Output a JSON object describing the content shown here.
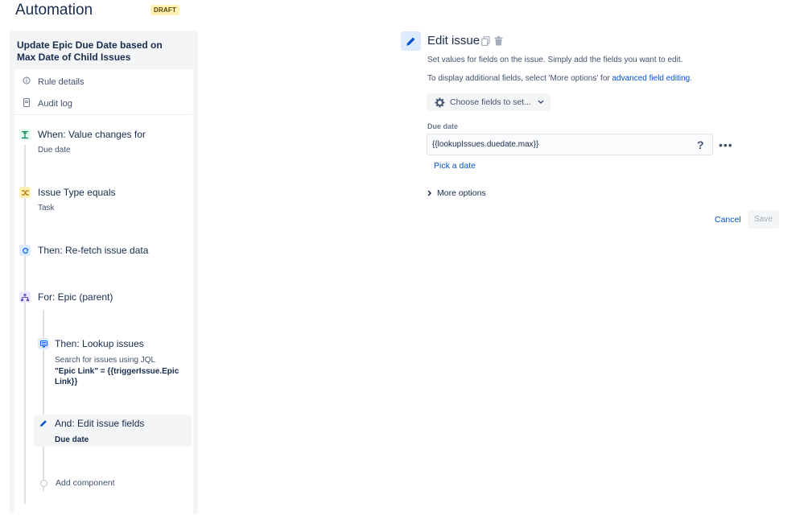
{
  "header": {
    "title": "Automation",
    "badge": "DRAFT"
  },
  "rule": {
    "name": "Update Epic Due Date based on Max Date of Child Issues",
    "meta": [
      {
        "label": "Rule details",
        "icon": "info-icon"
      },
      {
        "label": "Audit log",
        "icon": "document-icon"
      }
    ]
  },
  "steps": {
    "trigger": {
      "title": "When: Value changes for",
      "sub": "Due date",
      "icon": "trigger-icon",
      "color": "#00875a",
      "bg": "#e3fcef"
    },
    "condition": {
      "title": "Issue Type equals",
      "sub": "Task",
      "icon": "condition-icon",
      "color": "#ff991f",
      "bg": "#fff0b3"
    },
    "refetch": {
      "title": "Then: Re-fetch issue data",
      "icon": "refresh-icon",
      "color": "#0065ff",
      "bg": "#deebff"
    },
    "branch": {
      "title": "For: Epic (parent)",
      "icon": "branch-icon",
      "color": "#6554c0",
      "bg": "#eae6ff"
    },
    "lookup": {
      "title": "Then: Lookup issues",
      "sub1": "Search for issues using JQL",
      "sub2": "\"Epic Link\" = {{triggerIssue.Epic Link}}",
      "icon": "lookup-icon",
      "color": "#0065ff",
      "bg": "#deebff"
    },
    "edit": {
      "title": "And: Edit issue fields",
      "sub": "Due date",
      "icon": "pencil-icon",
      "color": "#0052cc",
      "bg": "#deebff"
    },
    "add": {
      "label": "Add component"
    }
  },
  "editor": {
    "title": "Edit issue",
    "desc1": "Set values for fields on the issue. Simply add the fields you want to edit.",
    "desc2_prefix": "To display additional fields, select 'More options' for ",
    "desc2_link": "advanced field editing",
    "desc2_suffix": ".",
    "choose_label": "Choose fields to set...",
    "field": {
      "label": "Due date",
      "value": "{{lookupIssues.duedate.max}}",
      "help": "?",
      "more": "•••"
    },
    "pick_label": "Pick a date",
    "more_options": "More options",
    "cancel": "Cancel",
    "save": "Save"
  }
}
